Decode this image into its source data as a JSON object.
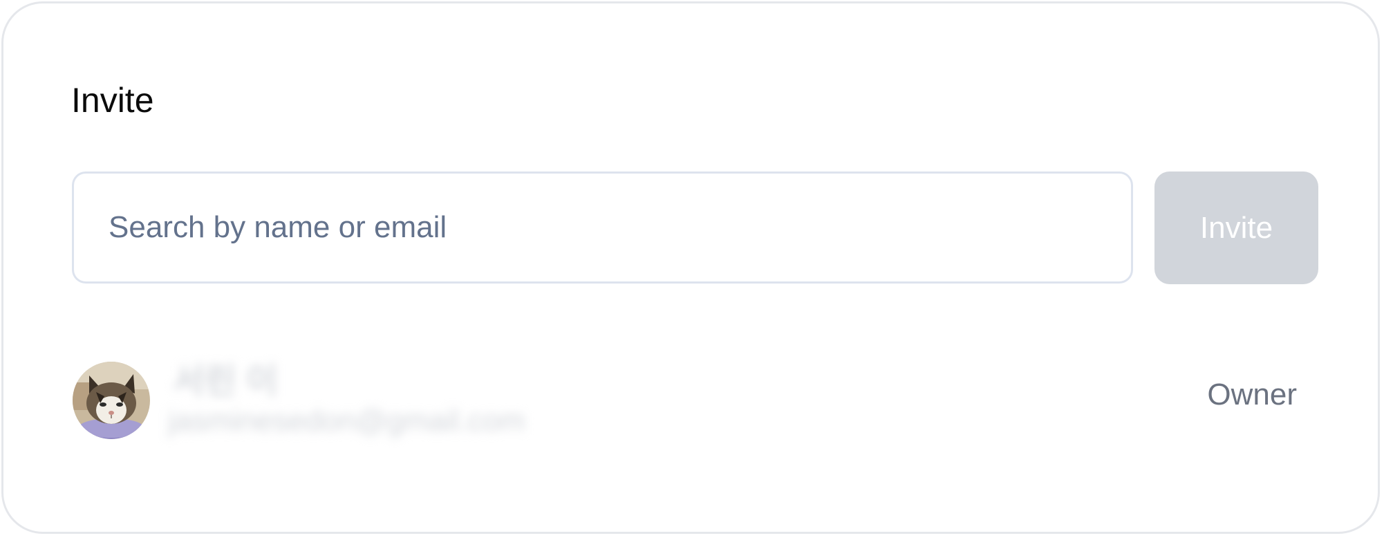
{
  "invite": {
    "title": "Invite",
    "search_placeholder": "Search by name or email",
    "search_value": "",
    "invite_button_label": "Invite"
  },
  "members": [
    {
      "name": "서린 이",
      "email": "jasminesedon@gmail.com",
      "role": "Owner",
      "avatar_icon": "cat-photo-avatar"
    }
  ],
  "colors": {
    "button_disabled_bg": "#d1d5db",
    "input_border": "#dde3ee",
    "placeholder_text": "#63728c",
    "role_text": "#6b7280"
  }
}
